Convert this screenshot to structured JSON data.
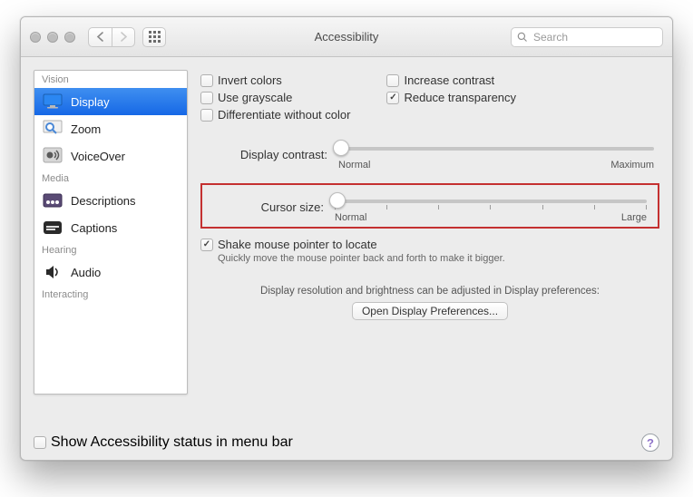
{
  "window": {
    "title": "Accessibility"
  },
  "search": {
    "placeholder": "Search"
  },
  "sidebar": {
    "groups": {
      "vision": "Vision",
      "media": "Media",
      "hearing": "Hearing",
      "interacting": "Interacting"
    },
    "items": {
      "display": "Display",
      "zoom": "Zoom",
      "voiceover": "VoiceOver",
      "descriptions": "Descriptions",
      "captions": "Captions",
      "audio": "Audio"
    }
  },
  "options": {
    "invert_colors": "Invert colors",
    "use_grayscale": "Use grayscale",
    "differentiate": "Differentiate without color",
    "increase_contrast": "Increase contrast",
    "reduce_transparency": "Reduce transparency"
  },
  "contrast": {
    "label": "Display contrast:",
    "min": "Normal",
    "max": "Maximum"
  },
  "cursor": {
    "label": "Cursor size:",
    "min": "Normal",
    "max": "Large"
  },
  "shake": {
    "label": "Shake mouse pointer to locate",
    "hint": "Quickly move the mouse pointer back and forth to make it bigger."
  },
  "resolution_note": "Display resolution and brightness can be adjusted in Display preferences:",
  "open_display_btn": "Open Display Preferences...",
  "footer": {
    "menu_bar": "Show Accessibility status in menu bar"
  }
}
